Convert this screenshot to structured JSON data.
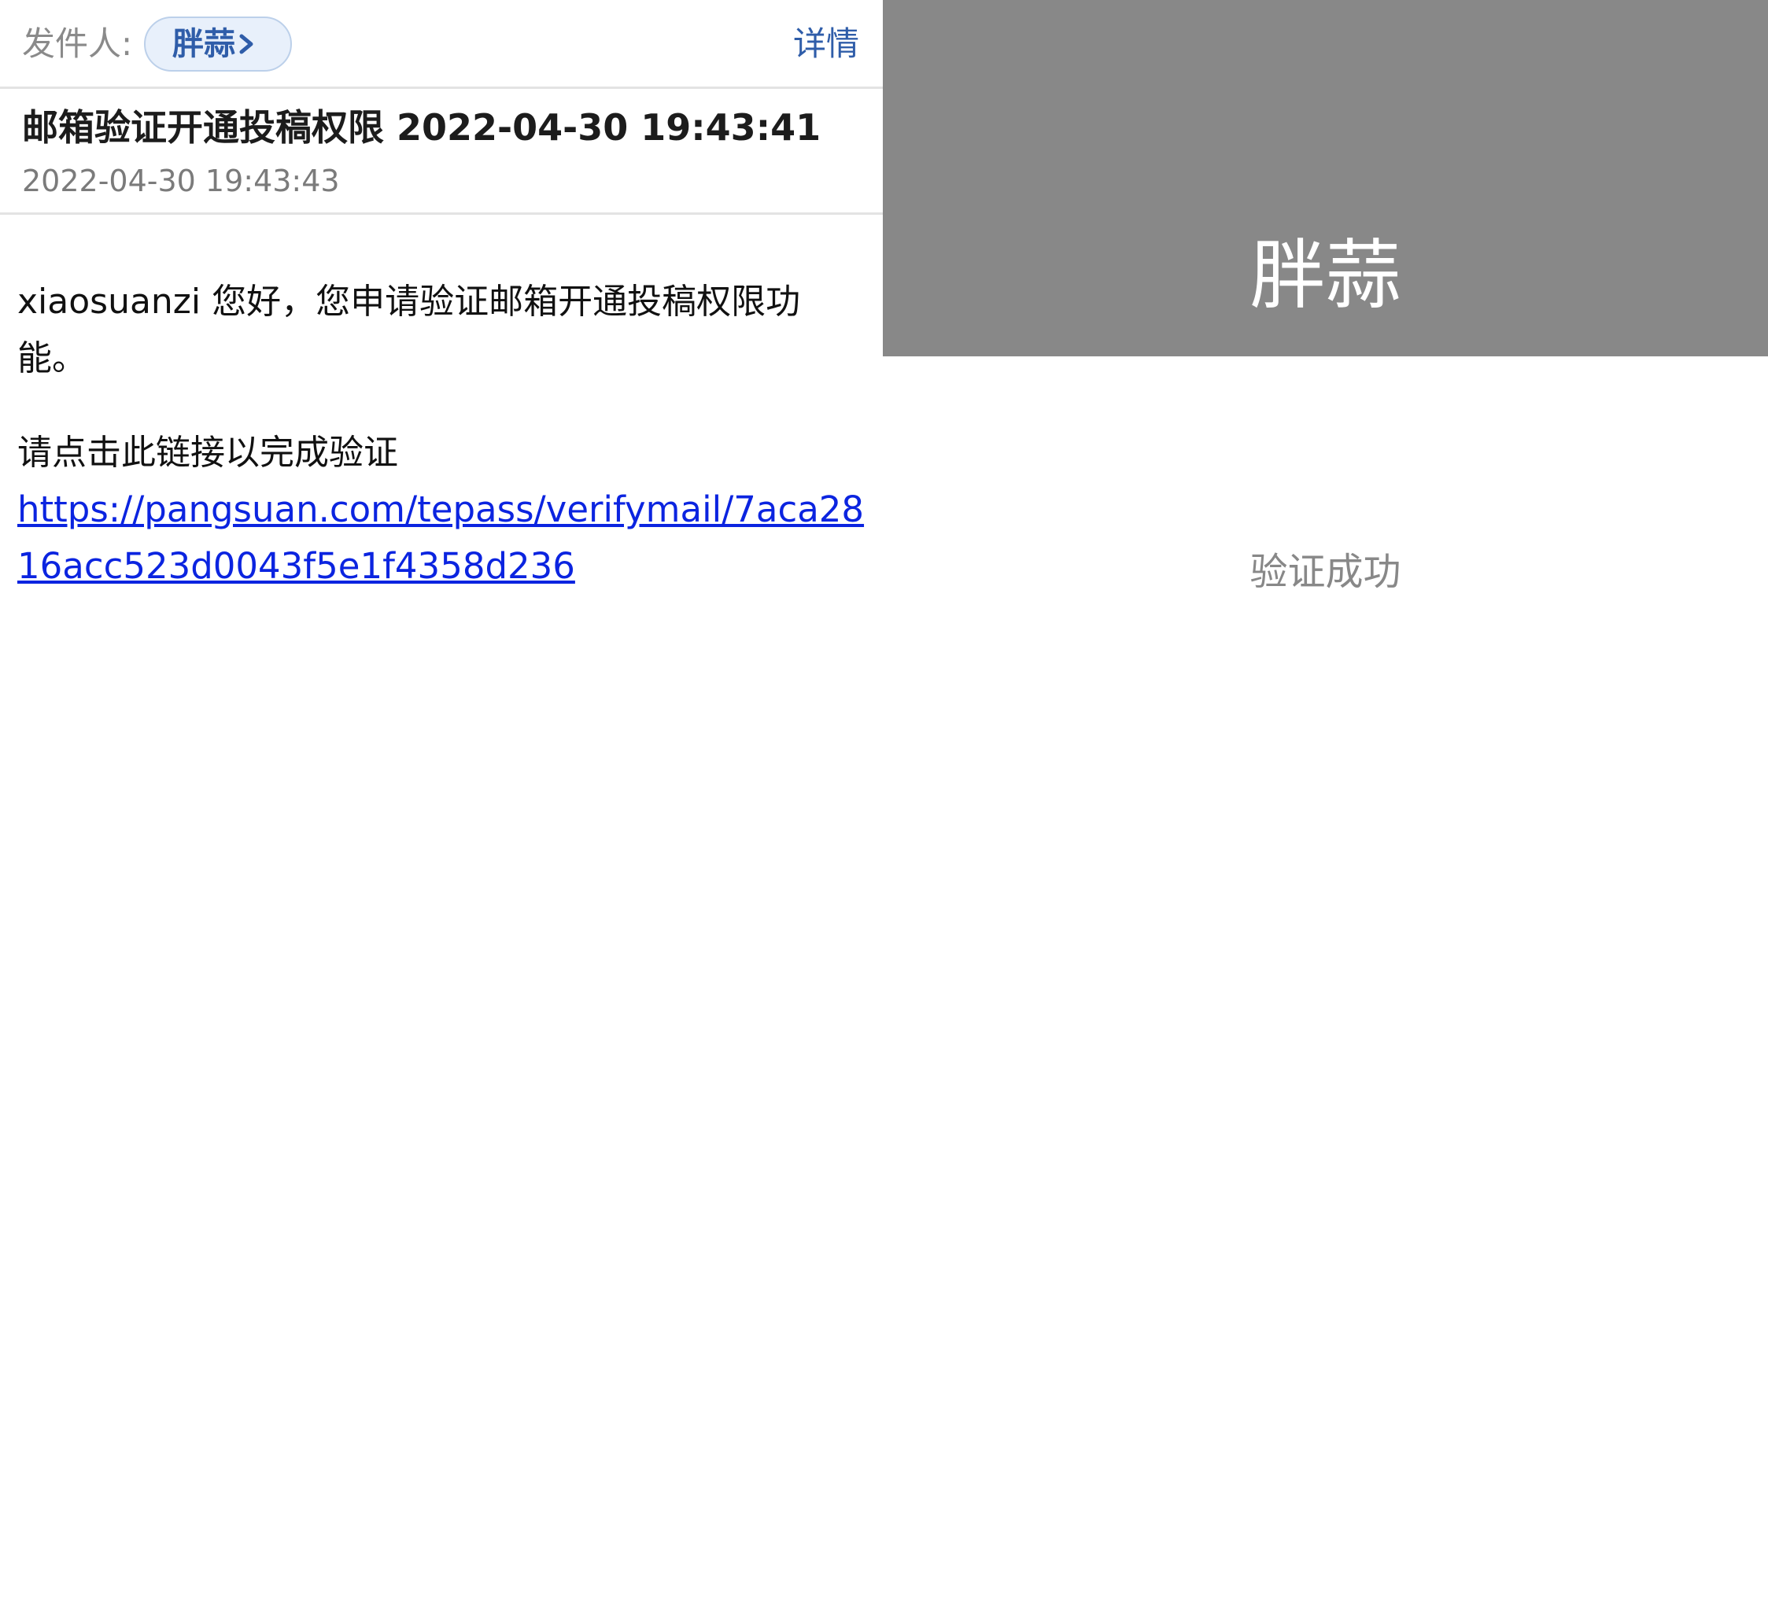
{
  "mail": {
    "sender_label": "发件人:",
    "sender_name": "胖蒜",
    "detail_label": "详情",
    "subject": "邮箱验证开通投稿权限 2022-04-30 19:43:41",
    "received_time": "2022-04-30 19:43:43",
    "body": {
      "greeting": "xiaosuanzi 您好，您申请验证邮箱开通投稿权限功能。",
      "instruction": "请点击此链接以完成验证",
      "link": "https://pangsuan.com/tepass/verifymail/7aca2816acc523d0043f5e1f4358d236"
    },
    "icons": {
      "chip_chevron": "chevron-right-icon"
    },
    "colors": {
      "accent": "#2f5da9",
      "link": "#0b24e0"
    }
  },
  "result": {
    "brand": "胖蒜",
    "message": "验证成功",
    "colors": {
      "header_bg": "#888888",
      "message": "#888888"
    }
  }
}
